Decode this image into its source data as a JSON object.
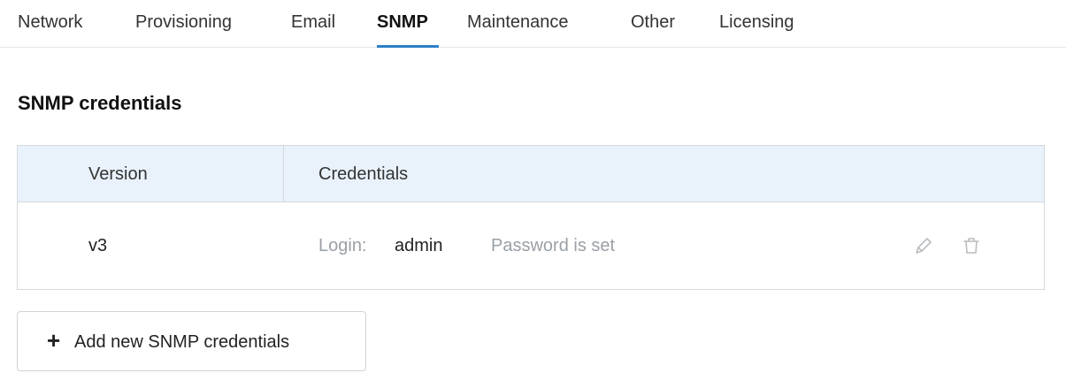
{
  "tabs": [
    {
      "label": "Network"
    },
    {
      "label": "Provisioning"
    },
    {
      "label": "Email"
    },
    {
      "label": "SNMP",
      "active": true
    },
    {
      "label": "Maintenance"
    },
    {
      "label": "Other"
    },
    {
      "label": "Licensing"
    }
  ],
  "section": {
    "title": "SNMP credentials"
  },
  "table": {
    "headers": {
      "version": "Version",
      "credentials": "Credentials"
    },
    "rows": [
      {
        "version": "v3",
        "login_label": "Login:",
        "login_value": "admin",
        "password_status": "Password is set",
        "actions": {
          "edit_icon": "pencil-icon",
          "delete_icon": "trash-icon"
        }
      }
    ]
  },
  "add_button": {
    "icon": "plus-icon",
    "label": "Add new SNMP credentials"
  },
  "colors": {
    "accent": "#2d7fc8",
    "header_bg": "#e9f2fb",
    "muted_text": "#9aa0a6"
  }
}
